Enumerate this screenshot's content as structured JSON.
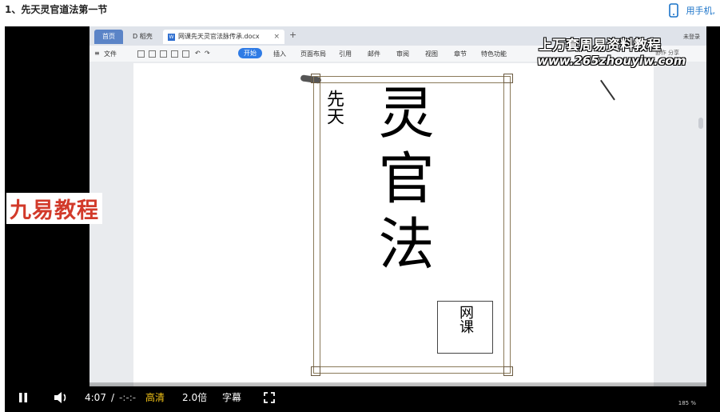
{
  "header": {
    "title": "1、先天灵官道法第一节",
    "phone_label": "用手机,"
  },
  "wps": {
    "tabs": {
      "home": "首页",
      "daoke": "稻壳",
      "doc": "网课先天灵官法脉传承.docx"
    },
    "menu": {
      "file": "文件",
      "start": "开始",
      "insert": "插入",
      "layout": "页面布局",
      "ref": "引用",
      "mail": "邮件",
      "review": "审阅",
      "view": "视图",
      "chapter": "章节",
      "special": "特色功能"
    },
    "right_ctl": "协作  分享",
    "login": "未登录"
  },
  "cover": {
    "small": "先天",
    "big": "灵官法",
    "box": "网课"
  },
  "watermark": {
    "top": "上万套周易资料教程",
    "url": "www.265zhouyiw.com",
    "left": "九易教程"
  },
  "controls": {
    "time_current": "4:07",
    "time_sep": "/",
    "time_total": "-:-:-",
    "quality": "高清",
    "rate": "2.0倍",
    "subtitles": "字幕"
  },
  "status_right": "185 %"
}
